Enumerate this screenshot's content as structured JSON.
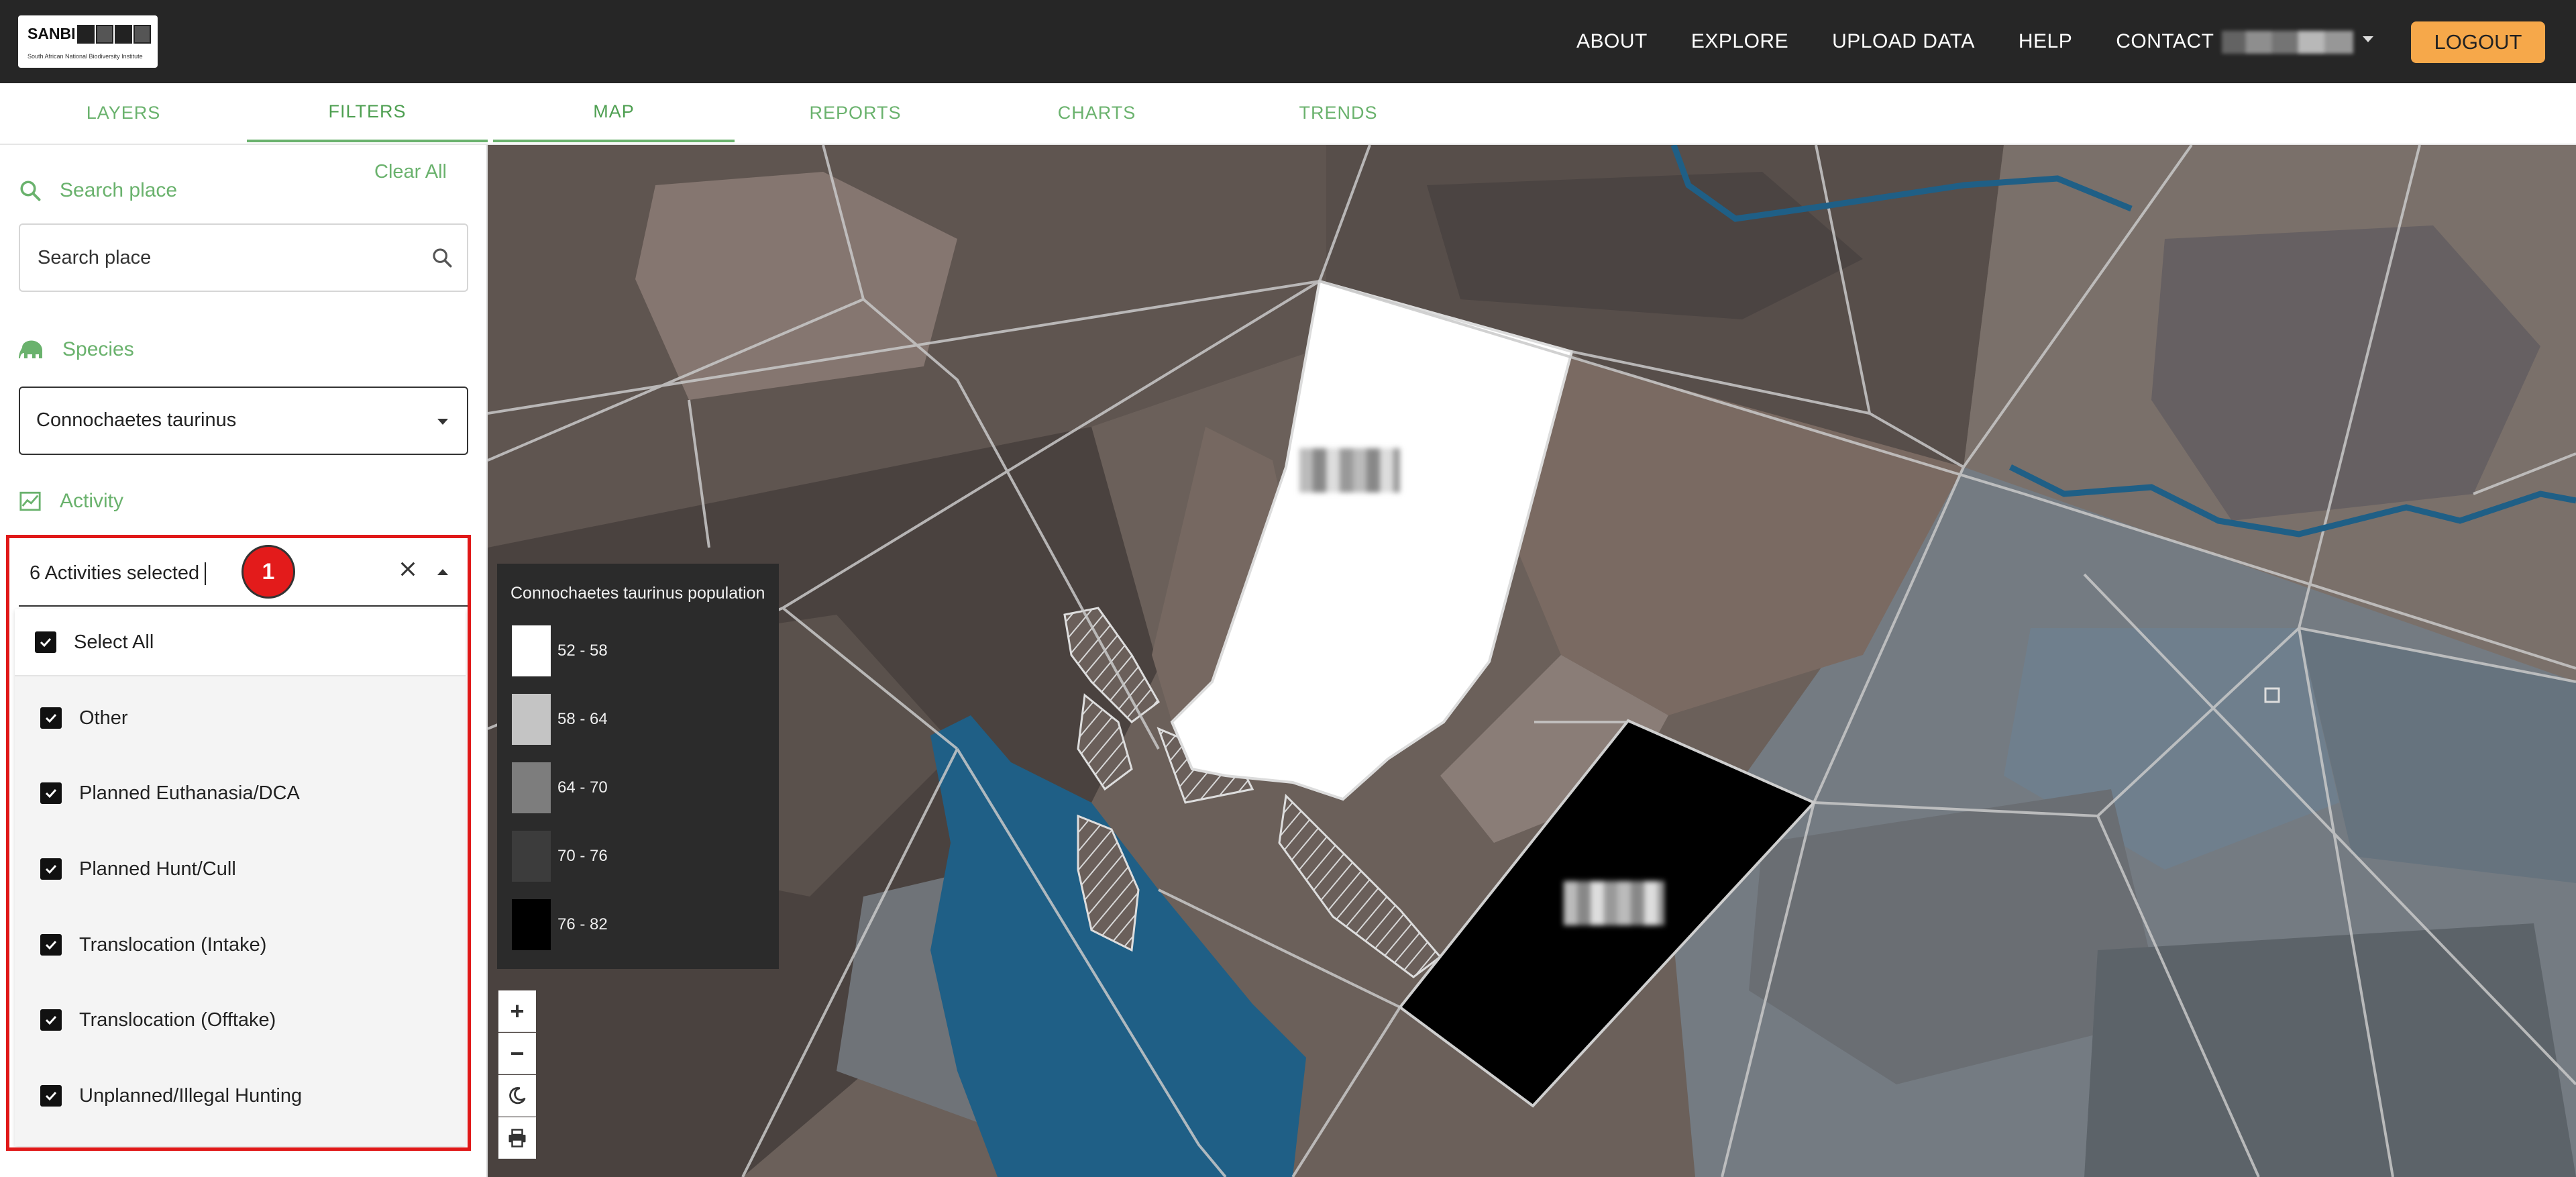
{
  "navbar": {
    "logo": {
      "title": "SANBI",
      "subtitle": "South African National Biodiversity Institute"
    },
    "links": [
      "ABOUT",
      "EXPLORE",
      "UPLOAD DATA",
      "HELP",
      "CONTACT"
    ],
    "logout_label": "LOGOUT",
    "accent_color": "#f6a84a"
  },
  "sidebar_tabs": [
    {
      "label": "LAYERS",
      "active": false
    },
    {
      "label": "FILTERS",
      "active": true
    }
  ],
  "main_tabs": [
    {
      "label": "MAP",
      "active": true
    },
    {
      "label": "REPORTS",
      "active": false
    },
    {
      "label": "CHARTS",
      "active": false
    },
    {
      "label": "TRENDS",
      "active": false
    }
  ],
  "filters": {
    "clear_all": "Clear All",
    "search": {
      "label": "Search place",
      "placeholder": "Search place",
      "icon": "search-icon"
    },
    "species": {
      "label": "Species",
      "value": "Connochaetes taurinus",
      "icon": "elephant-icon"
    },
    "activity": {
      "label": "Activity",
      "icon": "chart-line-icon",
      "value": "6 Activities selected",
      "annotation_badge": "1",
      "select_all_label": "Select All",
      "options": [
        {
          "label": "Other",
          "checked": true
        },
        {
          "label": "Planned Euthanasia/DCA",
          "checked": true
        },
        {
          "label": "Planned Hunt/Cull",
          "checked": true
        },
        {
          "label": "Translocation (Intake)",
          "checked": true
        },
        {
          "label": "Translocation (Offtake)",
          "checked": true
        },
        {
          "label": "Unplanned/Illegal Hunting",
          "checked": true
        }
      ]
    }
  },
  "map": {
    "legend": {
      "title": "Connochaetes taurinus population",
      "items": [
        {
          "range": "52 - 58",
          "color": "#ffffff"
        },
        {
          "range": "58 - 64",
          "color": "#c4c4c4"
        },
        {
          "range": "64 - 70",
          "color": "#7d7d7d"
        },
        {
          "range": "70 - 76",
          "color": "#3c3c3c"
        },
        {
          "range": "76 - 82",
          "color": "#000000"
        }
      ]
    },
    "controls": [
      "zoom-in-icon",
      "zoom-out-icon",
      "moon-icon",
      "print-icon"
    ]
  }
}
